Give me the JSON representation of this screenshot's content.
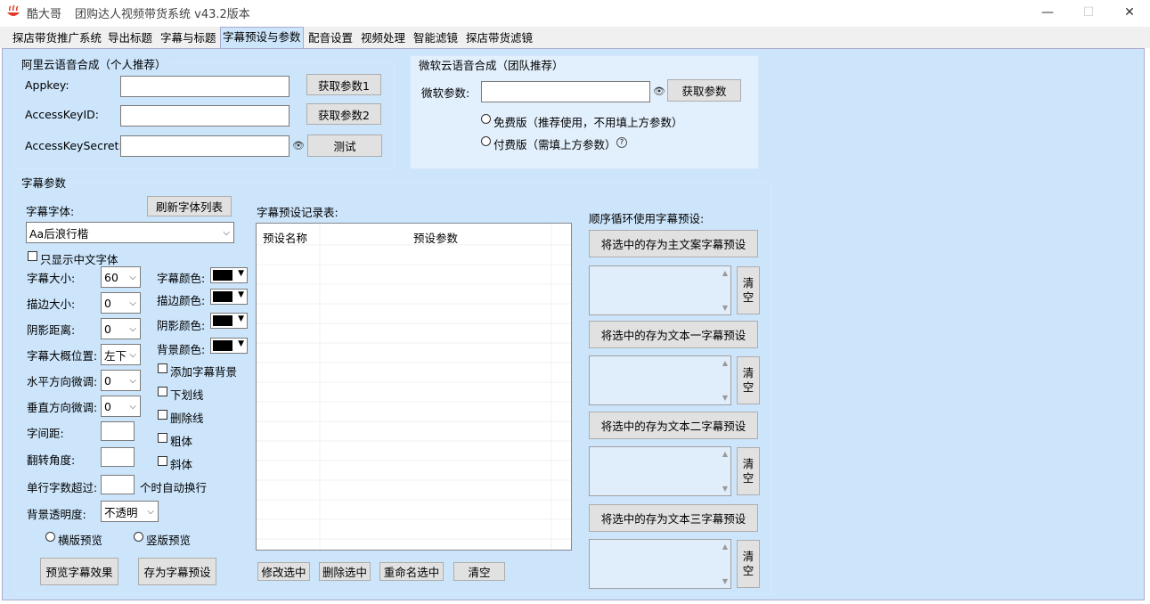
{
  "window": {
    "app_name": "酷大哥",
    "title": "团购达人视频带货系统   v43.2版本",
    "minimize": "—",
    "maximize": "☐",
    "close": "✕"
  },
  "tabs": [
    "探店带货推广系统",
    "导出标题",
    "字幕与标题",
    "字幕预设与参数",
    "配音设置",
    "视频处理",
    "智能滤镜",
    "探店带货滤镜"
  ],
  "aliyun": {
    "title": "阿里云语音合成（个人推荐）",
    "appkey_label": "Appkey:",
    "appkey_value": "",
    "accesskeyid_label": "AccessKeyID:",
    "accesskeyid_value": "",
    "accesskeysecret_label": "AccessKeySecret:",
    "accesskeysecret_value": "",
    "btn_param1": "获取参数1",
    "btn_param2": "获取参数2",
    "btn_test": "测试"
  },
  "microsoft": {
    "title": "微软云语音合成（团队推荐）",
    "param_label": "微软参数:",
    "param_value": "",
    "btn_get": "获取参数",
    "free_label": "免费版（推荐使用，不用填上方参数）",
    "paid_label": "付费版（需填上方参数）"
  },
  "subtitle": {
    "title": "字幕参数",
    "font_label": "字幕字体:",
    "refresh_fonts": "刷新字体列表",
    "font_value": "Aa后浪行楷",
    "chinese_only": "只显示中文字体",
    "size_label": "字幕大小:",
    "size_value": "60",
    "stroke_label": "描边大小:",
    "stroke_value": "0",
    "shadow_label": "阴影距离:",
    "shadow_value": "0",
    "pos_label": "字幕大概位置:",
    "pos_value": "左下",
    "hadj_label": "水平方向微调:",
    "hadj_value": "0",
    "vadj_label": "垂直方向微调:",
    "vadj_value": "0",
    "spacing_label": "字间距:",
    "rotate_label": "翻转角度:",
    "wrap_label": "单行字数超过:",
    "wrap_suffix": "个时自动换行",
    "opacity_label": "背景透明度:",
    "opacity_value": "不透明",
    "color_label": "字幕颜色:",
    "stroke_color_label": "描边颜色:",
    "shadow_color_label": "阴影颜色:",
    "bg_color_label": "背景颜色:",
    "add_bg": "添加字幕背景",
    "underline": "下划线",
    "strike": "删除线",
    "bold": "粗体",
    "italic": "斜体",
    "horizontal_preview": "横版预览",
    "vertical_preview": "竖版预览",
    "preview_btn": "预览字幕效果",
    "save_btn": "存为字幕预设"
  },
  "presets": {
    "label": "字幕预设记录表:",
    "col_name": "预设名称",
    "col_params": "预设参数",
    "edit_btn": "修改选中",
    "delete_btn": "删除选中",
    "rename_btn": "重命名选中",
    "clear_btn": "清空"
  },
  "cycle": {
    "label": "顺序循环使用字幕预设:",
    "main_btn": "将选中的存为主文案字幕预设",
    "text1_btn": "将选中的存为文本一字幕预设",
    "text2_btn": "将选中的存为文本二字幕预设",
    "text3_btn": "将选中的存为文本三字幕预设",
    "clear_top": "清",
    "clear_bottom": "空"
  },
  "colors": {
    "panel_bg": "#cce5fb",
    "swatch": "#000000"
  }
}
